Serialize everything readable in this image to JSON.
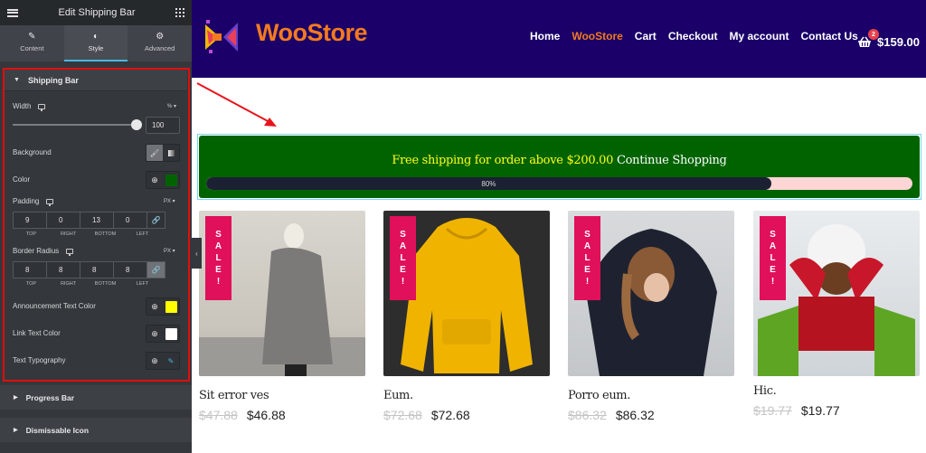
{
  "sidebar": {
    "title": "Edit Shipping Bar",
    "tabs": [
      {
        "label": "Content",
        "icon": "pencil-icon"
      },
      {
        "label": "Style",
        "icon": "contrast-icon",
        "active": true
      },
      {
        "label": "Advanced",
        "icon": "gear-icon"
      }
    ],
    "shipping_bar_section": {
      "title": "Shipping Bar",
      "width": {
        "label": "Width",
        "unit": "%",
        "value": "100",
        "slider_fraction": 1.0
      },
      "background": {
        "label": "Background",
        "options": [
          "classic",
          "gradient"
        ],
        "selected": "classic"
      },
      "color": {
        "label": "Color",
        "value": "#006300"
      },
      "padding": {
        "label": "Padding",
        "unit": "PX",
        "values": [
          "9",
          "0",
          "13",
          "0"
        ],
        "sides": [
          "TOP",
          "RIGHT",
          "BOTTOM",
          "LEFT"
        ],
        "linked": false
      },
      "border_radius": {
        "label": "Border Radius",
        "unit": "PX",
        "values": [
          "8",
          "8",
          "8",
          "8"
        ],
        "sides": [
          "TOP",
          "RIGHT",
          "BOTTOM",
          "LEFT"
        ],
        "linked": true
      },
      "announcement_text_color": {
        "label": "Announcement Text Color",
        "value": "#ffff00"
      },
      "link_text_color": {
        "label": "Link Text Color",
        "value": "#ffffff"
      },
      "text_typography": {
        "label": "Text Typography"
      }
    },
    "collapsed_sections": [
      "Progress Bar",
      "Dismissable Icon"
    ]
  },
  "site": {
    "brand": "WooStore",
    "brand_color": "#f37a1f",
    "nav": [
      {
        "label": "Home"
      },
      {
        "label": "WooStore",
        "active": true
      },
      {
        "label": "Cart"
      },
      {
        "label": "Checkout"
      },
      {
        "label": "My account"
      },
      {
        "label": "Contact Us"
      }
    ],
    "cart": {
      "count": "2",
      "total": "$159.00"
    },
    "shipping_bar": {
      "announcement": "Free shipping for order above $200.00",
      "link": "Continue Shopping",
      "progress_percent": 80,
      "progress_label": "80%",
      "bg_color": "#006300",
      "fill_color": "#1b2132",
      "track_color": "#ffd6d6"
    },
    "products": [
      {
        "name": "Sit error ves",
        "old_price": "$47.88",
        "price": "$46.88",
        "badge": "SALE!",
        "image": "woman-grey-coat-photo"
      },
      {
        "name": "Eum.",
        "old_price": "$72.68",
        "price": "$72.68",
        "badge": "SALE!",
        "image": "yellow-hoodie-photo"
      },
      {
        "name": "Porro eum.",
        "old_price": "$86.32",
        "price": "$86.32",
        "badge": "SALE!",
        "image": "girl-snow-jacket-photo"
      },
      {
        "name": "Hic.",
        "old_price": "$19.77",
        "price": "$19.77",
        "badge": "SALE!",
        "image": "child-red-mittens-photo"
      }
    ]
  }
}
